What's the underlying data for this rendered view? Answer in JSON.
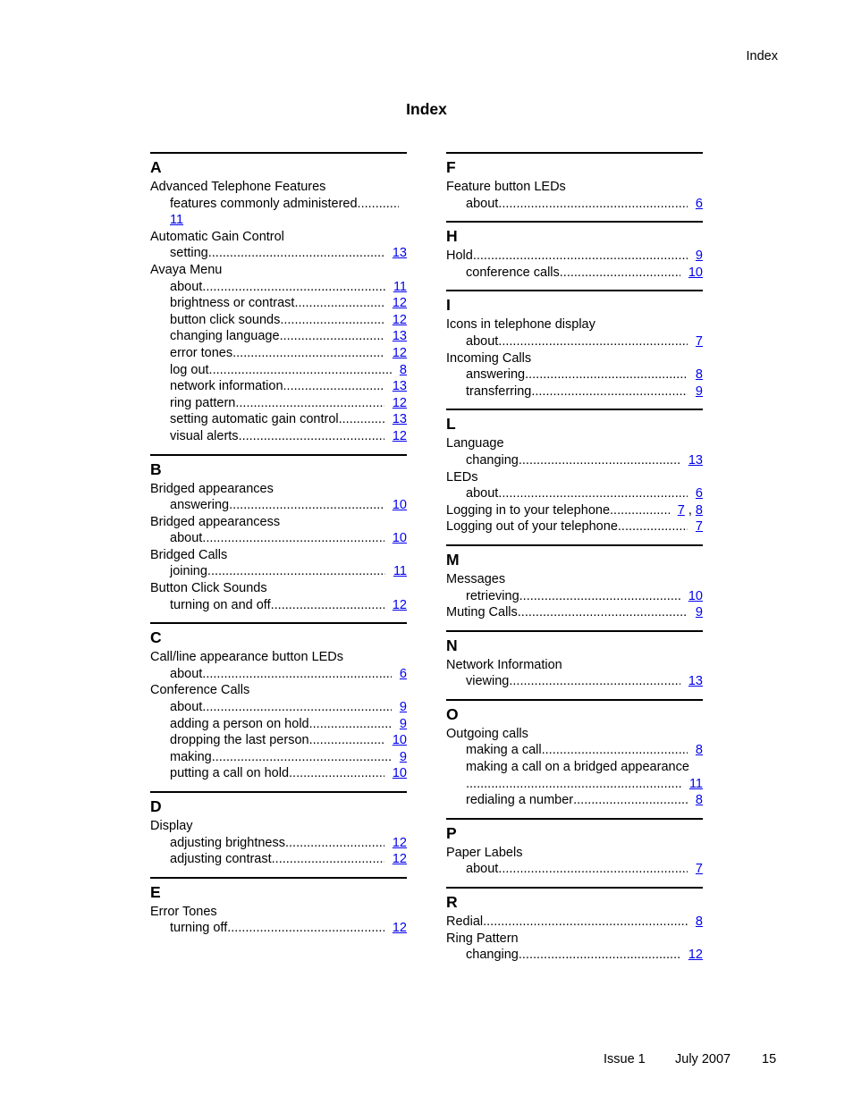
{
  "running_head": "Index",
  "title": "Index",
  "columns": [
    [
      {
        "letter": "A",
        "entries": [
          {
            "text": "Advanced Telephone Features",
            "subs": [
              {
                "text": "features commonly administered",
                "pages": [
                  "11"
                ],
                "wrap": true
              }
            ]
          },
          {
            "text": "Automatic Gain Control",
            "subs": [
              {
                "text": "setting",
                "pages": [
                  "13"
                ]
              }
            ]
          },
          {
            "text": "Avaya Menu",
            "subs": [
              {
                "text": "about",
                "pages": [
                  "11"
                ]
              },
              {
                "text": "brightness or contrast",
                "pages": [
                  "12"
                ]
              },
              {
                "text": "button click sounds",
                "pages": [
                  "12"
                ]
              },
              {
                "text": "changing language",
                "pages": [
                  "13"
                ]
              },
              {
                "text": "error tones",
                "pages": [
                  "12"
                ]
              },
              {
                "text": "log out",
                "pages": [
                  "8"
                ]
              },
              {
                "text": "network information",
                "pages": [
                  "13"
                ]
              },
              {
                "text": "ring pattern",
                "pages": [
                  "12"
                ]
              },
              {
                "text": "setting automatic gain control",
                "pages": [
                  "13"
                ]
              },
              {
                "text": "visual alerts",
                "pages": [
                  "12"
                ]
              }
            ]
          }
        ]
      },
      {
        "letter": "B",
        "entries": [
          {
            "text": "Bridged appearances",
            "subs": [
              {
                "text": "answering",
                "pages": [
                  "10"
                ]
              }
            ]
          },
          {
            "text": "Bridged appearancess",
            "subs": [
              {
                "text": "about",
                "pages": [
                  "10"
                ]
              }
            ]
          },
          {
            "text": "Bridged Calls",
            "subs": [
              {
                "text": "joining",
                "pages": [
                  "11"
                ]
              }
            ]
          },
          {
            "text": "Button Click Sounds",
            "subs": [
              {
                "text": "turning on and off",
                "pages": [
                  "12"
                ]
              }
            ]
          }
        ]
      },
      {
        "letter": "C",
        "entries": [
          {
            "text": "Call/line appearance button LEDs",
            "subs": [
              {
                "text": "about",
                "pages": [
                  "6"
                ]
              }
            ]
          },
          {
            "text": "Conference Calls",
            "subs": [
              {
                "text": "about",
                "pages": [
                  "9"
                ]
              },
              {
                "text": "adding a person on hold",
                "pages": [
                  "9"
                ]
              },
              {
                "text": "dropping the last person",
                "pages": [
                  "10"
                ]
              },
              {
                "text": "making",
                "pages": [
                  "9"
                ]
              },
              {
                "text": "putting a call on hold",
                "pages": [
                  "10"
                ]
              }
            ]
          }
        ]
      },
      {
        "letter": "D",
        "entries": [
          {
            "text": "Display",
            "subs": [
              {
                "text": "adjusting brightness",
                "pages": [
                  "12"
                ]
              },
              {
                "text": "adjusting contrast",
                "pages": [
                  "12"
                ]
              }
            ]
          }
        ]
      },
      {
        "letter": "E",
        "entries": [
          {
            "text": "Error Tones",
            "subs": [
              {
                "text": "turning off",
                "pages": [
                  "12"
                ]
              }
            ]
          }
        ]
      }
    ],
    [
      {
        "letter": "F",
        "entries": [
          {
            "text": "Feature button LEDs",
            "subs": [
              {
                "text": "about",
                "pages": [
                  "6"
                ]
              }
            ]
          }
        ]
      },
      {
        "letter": "H",
        "entries": [
          {
            "text": "Hold",
            "pages": [
              "9"
            ],
            "subs": [
              {
                "text": "conference calls",
                "pages": [
                  "10"
                ]
              }
            ]
          }
        ]
      },
      {
        "letter": "I",
        "entries": [
          {
            "text": "Icons in telephone display",
            "subs": [
              {
                "text": "about",
                "pages": [
                  "7"
                ]
              }
            ]
          },
          {
            "text": "Incoming Calls",
            "subs": [
              {
                "text": "answering",
                "pages": [
                  "8"
                ]
              },
              {
                "text": "transferring",
                "pages": [
                  "9"
                ]
              }
            ]
          }
        ]
      },
      {
        "letter": "L",
        "entries": [
          {
            "text": "Language",
            "subs": [
              {
                "text": "changing",
                "pages": [
                  "13"
                ]
              }
            ]
          },
          {
            "text": "LEDs",
            "subs": [
              {
                "text": "about",
                "pages": [
                  "6"
                ]
              }
            ]
          },
          {
            "text": "Logging in to your telephone",
            "pages": [
              "7",
              "8"
            ],
            "subs": []
          },
          {
            "text": "Logging out of your telephone",
            "pages": [
              "7"
            ],
            "subs": []
          }
        ]
      },
      {
        "letter": "M",
        "entries": [
          {
            "text": "Messages",
            "subs": [
              {
                "text": "retrieving",
                "pages": [
                  "10"
                ]
              }
            ]
          },
          {
            "text": "Muting Calls",
            "pages": [
              "9"
            ],
            "subs": []
          }
        ]
      },
      {
        "letter": "N",
        "entries": [
          {
            "text": "Network Information",
            "subs": [
              {
                "text": "viewing",
                "pages": [
                  "13"
                ]
              }
            ]
          }
        ]
      },
      {
        "letter": "O",
        "entries": [
          {
            "text": "Outgoing calls",
            "subs": [
              {
                "text": "making a call",
                "pages": [
                  "8"
                ]
              },
              {
                "text": "making a call on a bridged appearance",
                "pages": [
                  "11"
                ],
                "wrap_dots": true
              },
              {
                "text": "redialing a number",
                "pages": [
                  "8"
                ]
              }
            ]
          }
        ]
      },
      {
        "letter": "P",
        "entries": [
          {
            "text": "Paper Labels",
            "subs": [
              {
                "text": "about",
                "pages": [
                  "7"
                ]
              }
            ]
          }
        ]
      },
      {
        "letter": "R",
        "entries": [
          {
            "text": "Redial",
            "pages": [
              "8"
            ],
            "subs": []
          },
          {
            "text": "Ring Pattern",
            "subs": [
              {
                "text": "changing",
                "pages": [
                  "12"
                ]
              }
            ]
          }
        ]
      }
    ]
  ],
  "footer": {
    "issue": "Issue 1",
    "date": "July 2007",
    "page_number": "15"
  },
  "colors": {
    "link": "#0000ee",
    "text": "#000000"
  }
}
